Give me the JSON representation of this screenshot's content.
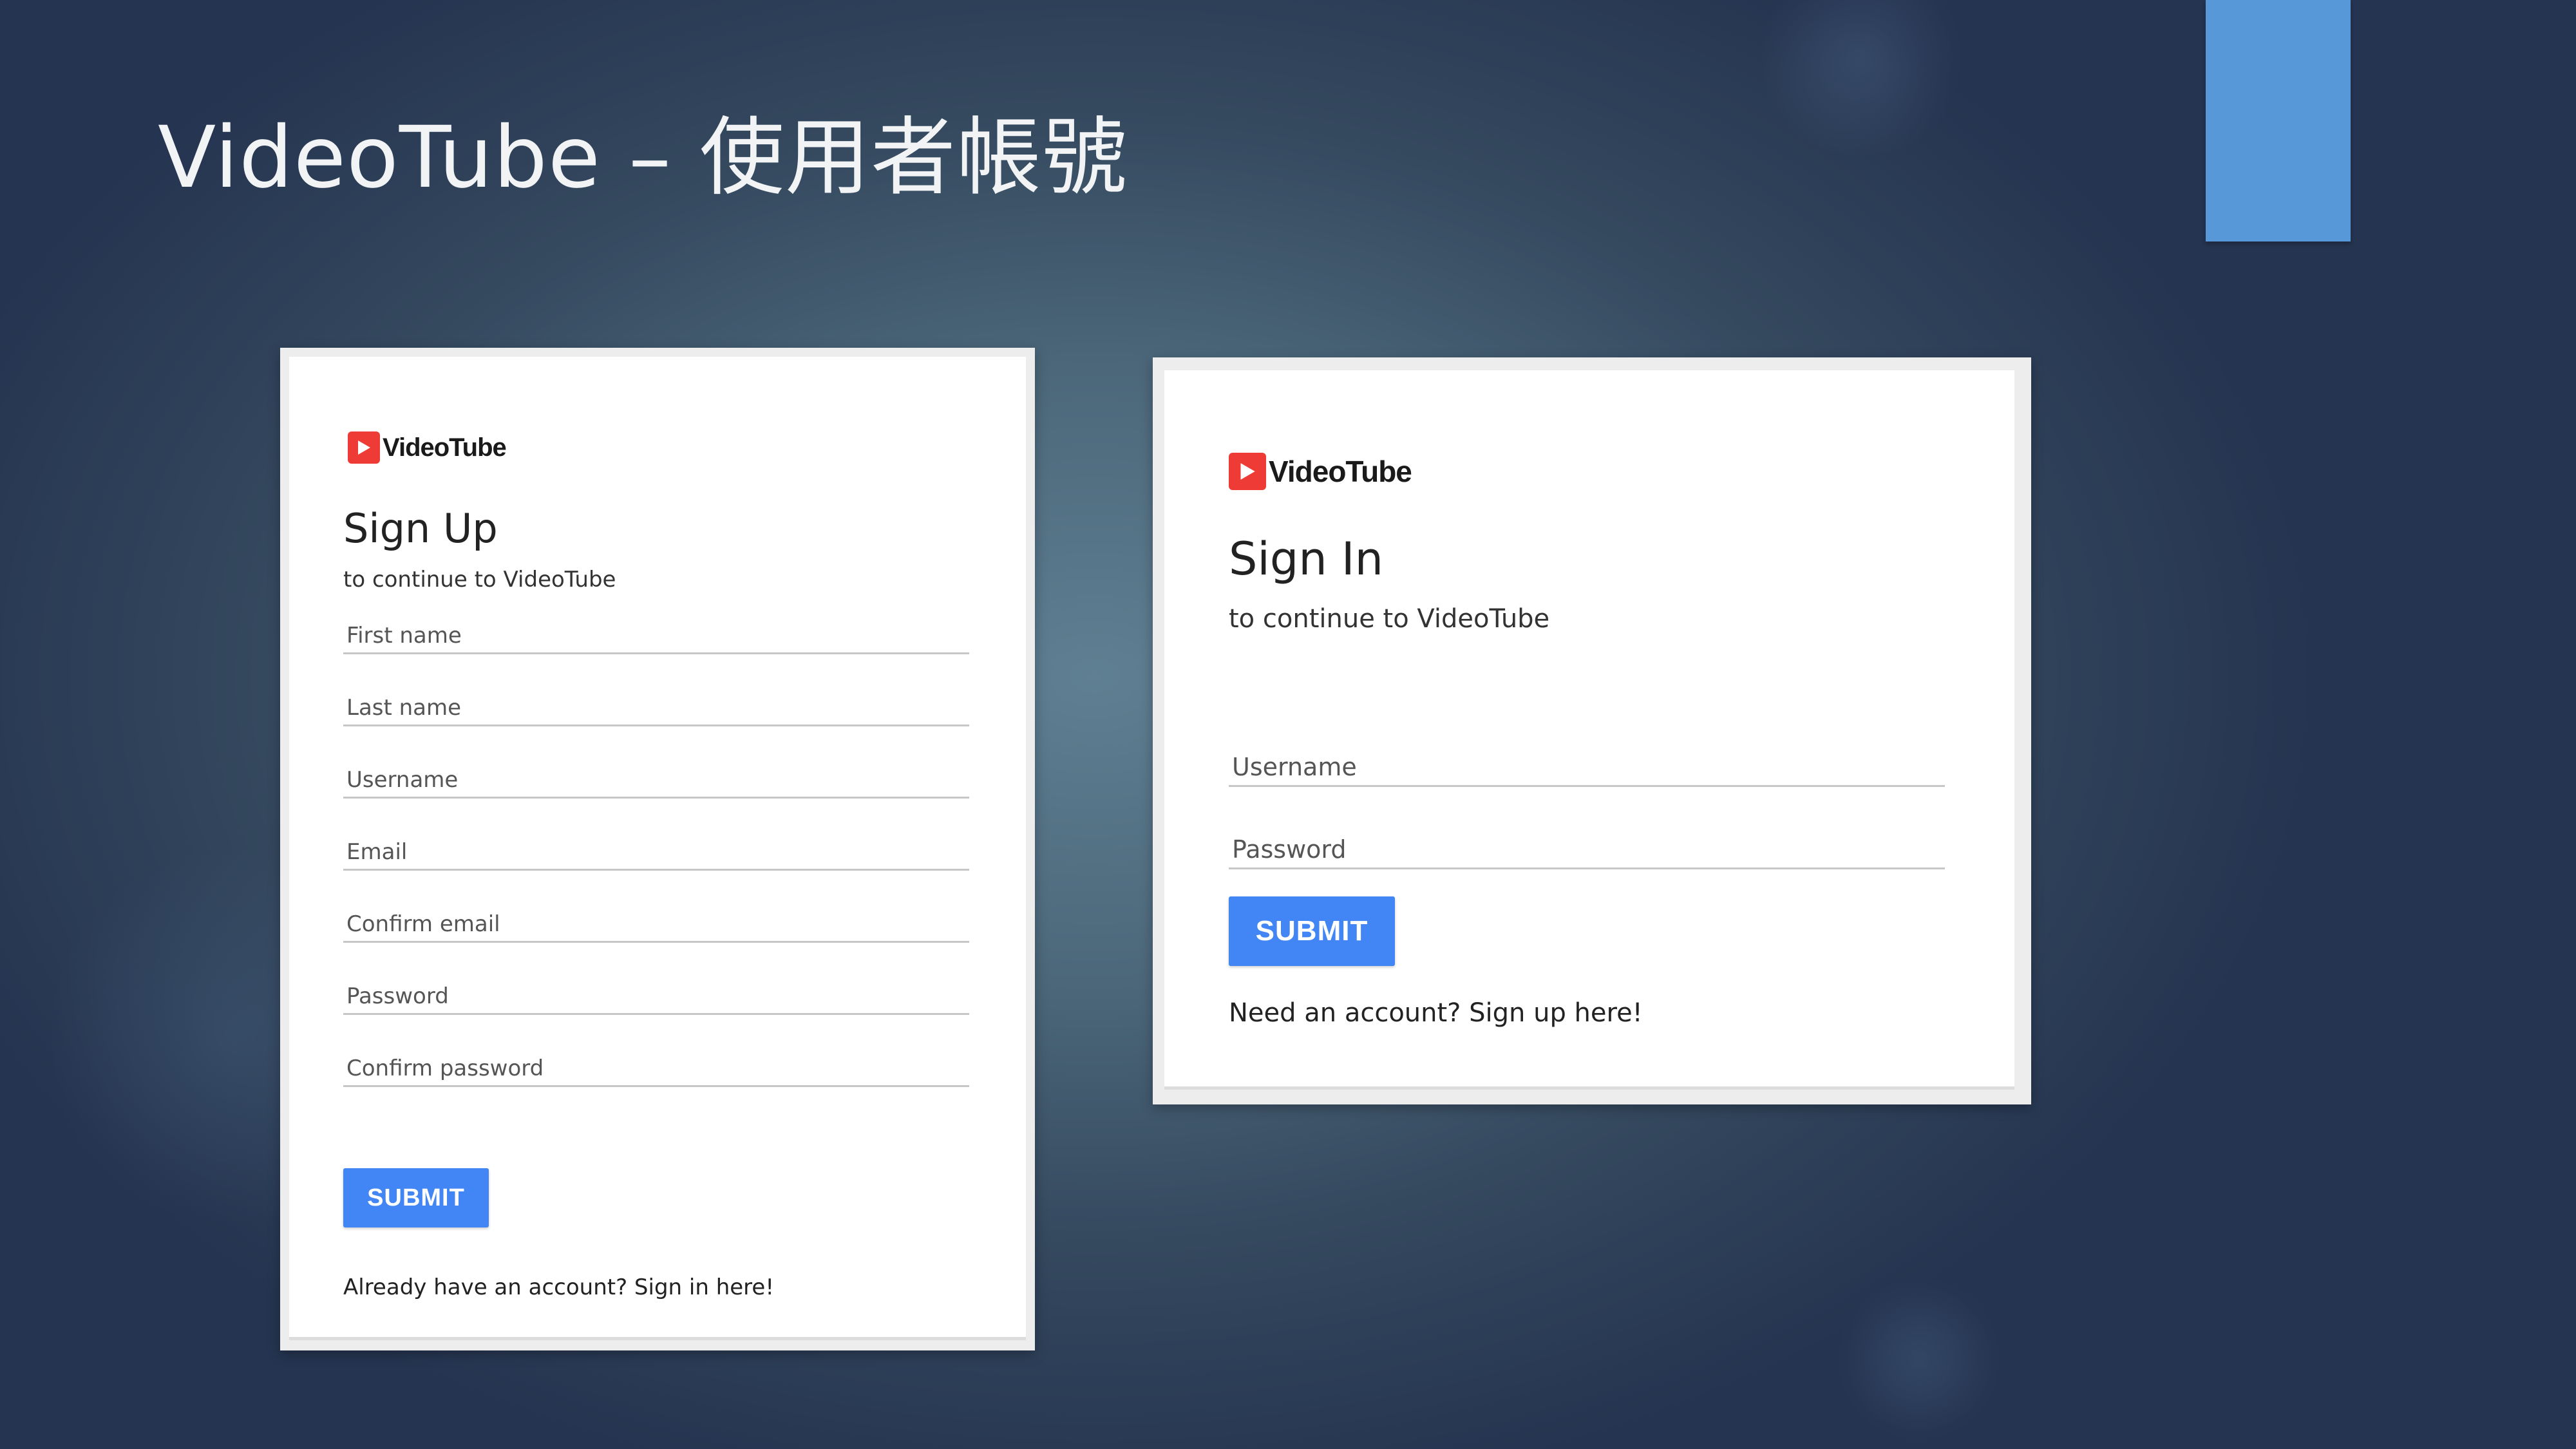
{
  "slide": {
    "title": "VideoTube – 使用者帳號"
  },
  "brand": {
    "name": "VideoTube",
    "icon": "play-logo-icon",
    "icon_color": "#ee3b35"
  },
  "colors": {
    "accent_block": "#5799d8",
    "submit_button": "#4285f4"
  },
  "signup": {
    "heading": "Sign Up",
    "subheading": "to continue to VideoTube",
    "fields": [
      {
        "placeholder": "First name"
      },
      {
        "placeholder": "Last name"
      },
      {
        "placeholder": "Username"
      },
      {
        "placeholder": "Email"
      },
      {
        "placeholder": "Confirm email"
      },
      {
        "placeholder": "Password"
      },
      {
        "placeholder": "Confirm password"
      }
    ],
    "submit_label": "SUBMIT",
    "footer_text": "Already have an account? Sign in here!"
  },
  "signin": {
    "heading": "Sign In",
    "subheading": "to continue to VideoTube",
    "fields": [
      {
        "placeholder": "Username"
      },
      {
        "placeholder": "Password"
      }
    ],
    "submit_label": "SUBMIT",
    "footer_text": "Need an account? Sign up here!"
  }
}
